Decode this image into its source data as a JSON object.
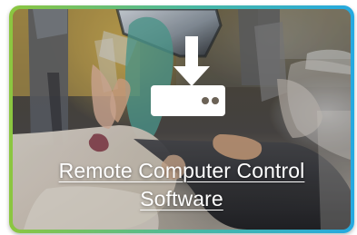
{
  "card": {
    "title_line_1": "Remote Computer Control",
    "title_line_2": "Software",
    "icon": "download-to-drive-icon",
    "border_gradient": [
      "#8cc63f",
      "#47b7a4",
      "#25a9e0"
    ],
    "text_color": "#ffffff"
  }
}
